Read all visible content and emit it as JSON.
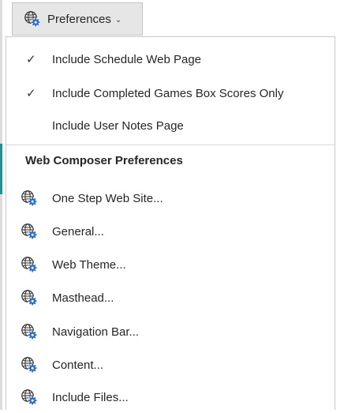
{
  "toolbar": {
    "button_label": "Preferences",
    "button_icon": "globe-gear-icon",
    "chevron_icon": "chevron-down-icon"
  },
  "menu": {
    "check_items": [
      {
        "label": "Include Schedule Web Page",
        "checked": true
      },
      {
        "label": "Include Completed Games Box Scores Only",
        "checked": true
      },
      {
        "label": "Include User Notes Page",
        "checked": false
      }
    ],
    "section_header": "Web Composer Preferences",
    "pref_items": [
      {
        "label": "One Step Web Site...",
        "icon": "globe-gear-icon"
      },
      {
        "label": "General...",
        "icon": "globe-gear-icon"
      },
      {
        "label": "Web Theme...",
        "icon": "globe-gear-icon"
      },
      {
        "label": "Masthead...",
        "icon": "globe-gear-icon"
      },
      {
        "label": "Navigation Bar...",
        "icon": "globe-gear-icon"
      },
      {
        "label": "Content...",
        "icon": "globe-gear-icon"
      },
      {
        "label": "Include Files...",
        "icon": "globe-gear-icon"
      }
    ]
  },
  "colors": {
    "button_bg": "#e6e6e6",
    "menu_bg": "#ffffff",
    "separator": "#d9d9d9",
    "icon_blue": "#2b6cc4",
    "icon_dark": "#3a3a3a"
  }
}
